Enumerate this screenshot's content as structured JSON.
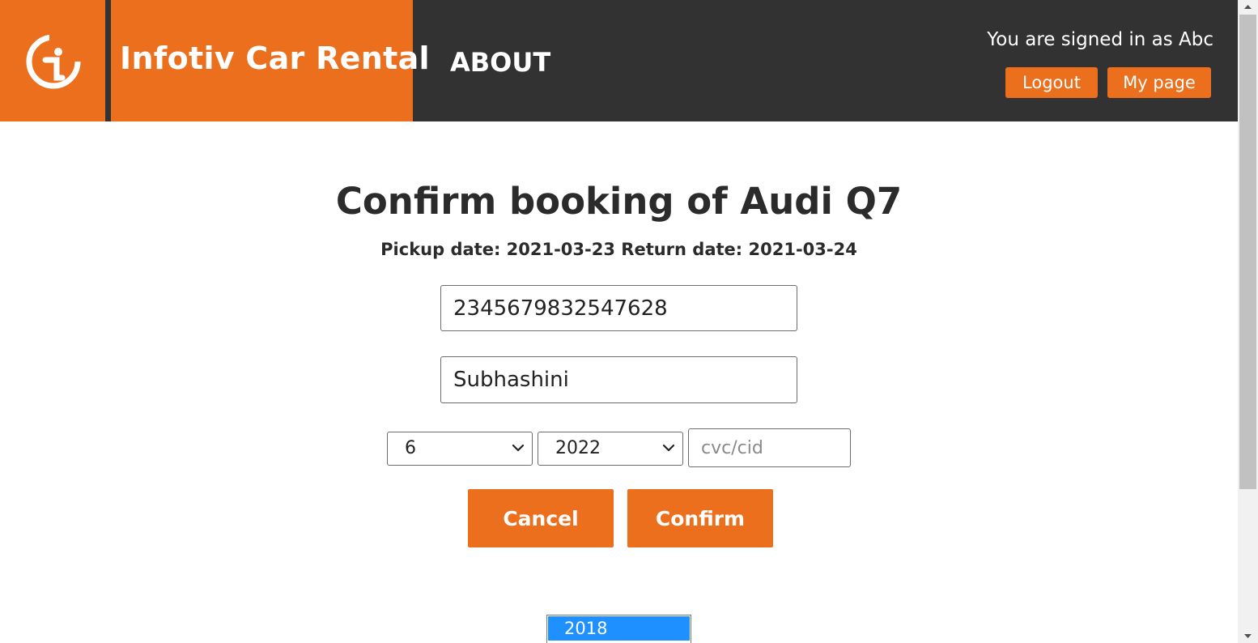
{
  "header": {
    "brand_title": "Infotiv Car Rental",
    "nav_about": "ABOUT",
    "signed_in_text": "You are signed in as Abc",
    "logout_label": "Logout",
    "mypage_label": "My page",
    "logo_icon": "infotiv-logo-icon"
  },
  "main": {
    "title": "Confirm booking of Audi Q7",
    "dates_line": "Pickup date: 2021-03-23 Return date: 2021-03-24",
    "card_number_value": "2345679832547628",
    "card_name_value": "Subhashini",
    "expiry_month_value": "6",
    "expiry_year_value": "2022",
    "cvc_placeholder": "cvc/cid",
    "cancel_label": "Cancel",
    "confirm_label": "Confirm"
  },
  "dropdown": {
    "highlighted_option": "2018"
  },
  "colors": {
    "brand_orange": "#ec6f1e",
    "header_dark": "#323232",
    "highlight_blue": "#1e90ff"
  }
}
